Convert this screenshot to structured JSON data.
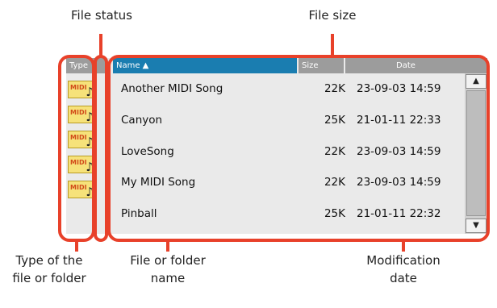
{
  "callouts": {
    "file_status": "File status",
    "file_size": "File size",
    "type": "Type of the\nfile or folder",
    "name": "File or folder\nname",
    "date": "Modification\ndate"
  },
  "headers": {
    "type": "Type",
    "name": "Name ▲",
    "size": "Size",
    "date": "Date"
  },
  "files": [
    {
      "icon": "midi-file-icon",
      "badge": "MIDI",
      "name": "Another MIDI Song",
      "size": "22K",
      "date": "23-09-03 14:59"
    },
    {
      "icon": "midi-file-icon",
      "badge": "MIDI",
      "name": "Canyon",
      "size": "25K",
      "date": "21-01-11 22:33"
    },
    {
      "icon": "midi-file-icon",
      "badge": "MIDI",
      "name": "LoveSong",
      "size": "22K",
      "date": "23-09-03 14:59"
    },
    {
      "icon": "midi-file-icon",
      "badge": "MIDI",
      "name": "My MIDI Song",
      "size": "22K",
      "date": "23-09-03 14:59"
    },
    {
      "icon": "midi-file-icon",
      "badge": "MIDI",
      "name": "Pinball",
      "size": "25K",
      "date": "21-01-11 22:32"
    }
  ],
  "scrollbar": {
    "up": "▲",
    "down": "▼"
  },
  "colors": {
    "callout_line": "#e8412a",
    "name_header": "#1a7db0",
    "header": "#9c9c9c"
  }
}
